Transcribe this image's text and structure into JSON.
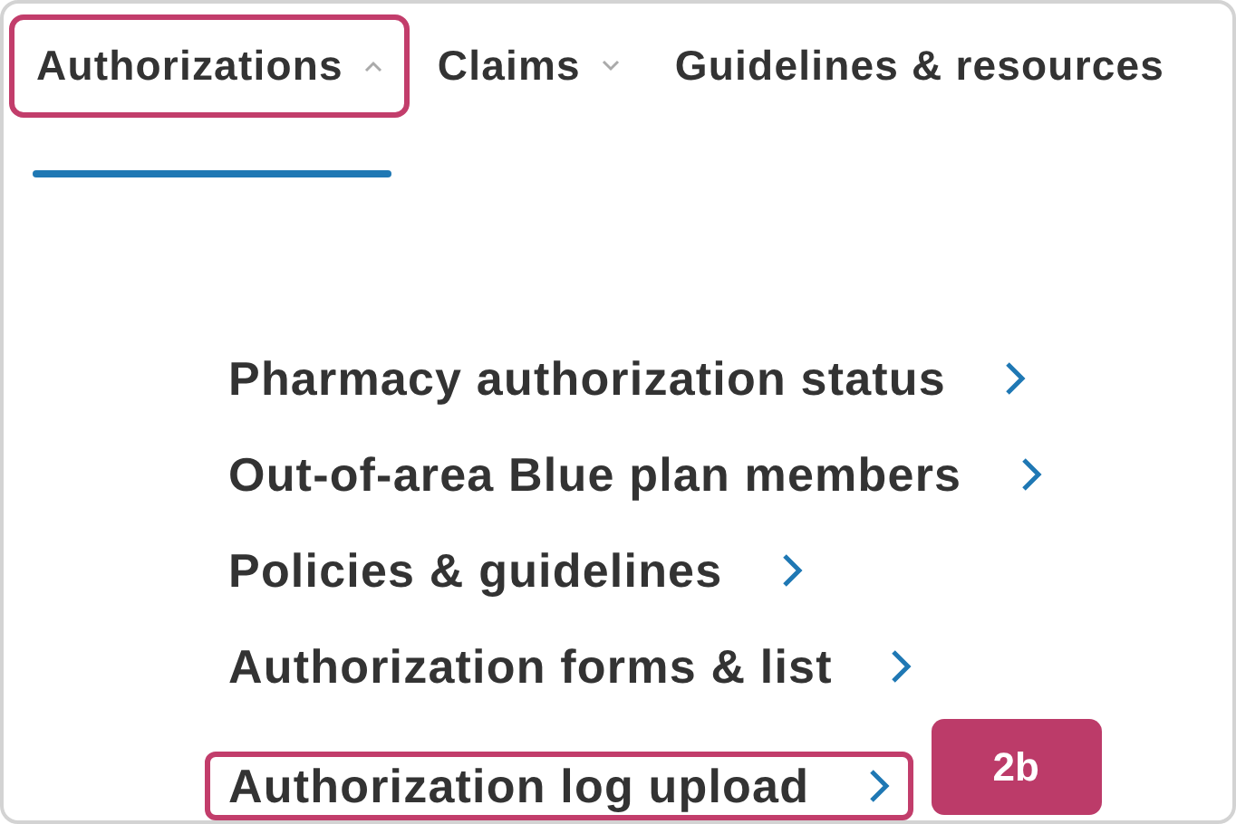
{
  "nav_tabs": [
    {
      "label": "Authorizations",
      "kind": "dropdown",
      "expanded": true,
      "selected": true,
      "highlighted": true
    },
    {
      "label": "Claims",
      "kind": "dropdown",
      "expanded": false,
      "selected": false,
      "highlighted": false
    },
    {
      "label": "Guidelines & resources",
      "kind": "link",
      "selected": false,
      "highlighted": false
    }
  ],
  "menu_items": [
    {
      "label": "Pharmacy authorization status",
      "highlighted": false
    },
    {
      "label": "Out-of-area Blue plan members",
      "highlighted": false
    },
    {
      "label": "Policies & guidelines",
      "highlighted": false
    },
    {
      "label": "Authorization forms & list",
      "highlighted": false
    },
    {
      "label": "Authorization log upload",
      "highlighted": true
    }
  ],
  "callout": {
    "label": "2b"
  }
}
